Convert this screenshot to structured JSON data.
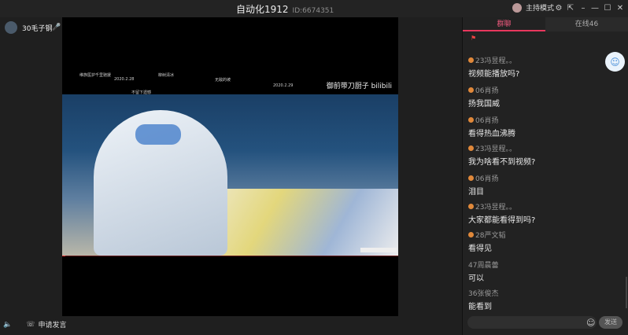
{
  "titlebar": {
    "title": "自动化1912",
    "room_id": "ID:6674351",
    "host_mode_label": "主持模式",
    "icons": [
      "settings-icon",
      "share-icon",
      "minimize-icon",
      "maximize-icon",
      "close-icon"
    ]
  },
  "stage": {
    "host_name": "30毛子钢",
    "mic_queue_label": "排麦",
    "video_watermark": "御前带刀厨子 bilibili",
    "danmaku": [
      "维族医护千里驰援",
      "2020.2.28",
      "柳树清冰",
      "2020.2.29",
      "无敌的坡",
      "不留下遗憾"
    ]
  },
  "bottom": {
    "apply_label": "申请发言"
  },
  "panel": {
    "tabs": [
      "群聊",
      "在线46"
    ],
    "messages": [
      {
        "sender": "23冯昱程。。",
        "text": "视频能播放吗?"
      },
      {
        "sender": "06肖扬",
        "text": "扬我国威"
      },
      {
        "sender": "06肖扬",
        "text": "看得热血沸腾"
      },
      {
        "sender": "23冯昱程。。",
        "text": "我为啥看不到视频?"
      },
      {
        "sender": "06肖扬",
        "text": "泪目"
      },
      {
        "sender": "23冯昱程。。",
        "text": "大家都能看得到吗?"
      },
      {
        "sender": "28严文韬",
        "text": "看得见"
      },
      {
        "sender": "47周晨蕾",
        "text": "可以"
      },
      {
        "sender": "36张俊杰",
        "text": "能看到"
      }
    ],
    "send_label": "发送"
  },
  "colors": {
    "accent": "#e8375d",
    "badge": "#e0883a"
  }
}
